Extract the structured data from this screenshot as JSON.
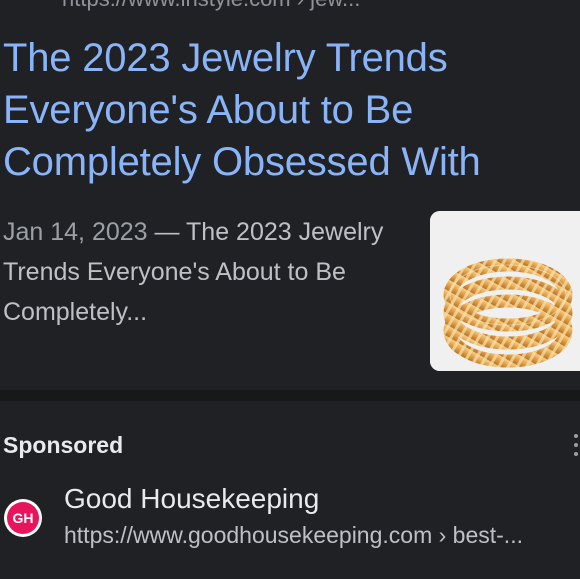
{
  "result": {
    "top_url": "https://www.instyle.com › jew...",
    "title": "The 2023 Jewelry Trends Everyone's About to Be Completely Obsessed With",
    "date": "Jan 14, 2023",
    "separator": " — ",
    "snippet": "The 2023 Jewelry Trends Everyone's About to Be Completely...",
    "thumbnail": "gold-coil-ring-image"
  },
  "ad": {
    "label": "Sponsored",
    "favicon_text": "GH",
    "site_name": "Good Housekeeping",
    "url": "https://www.goodhousekeeping.com",
    "url_path": " › best-..."
  },
  "colors": {
    "background": "#202124",
    "title": "#8ab4f8",
    "favicon": "#e8155d"
  }
}
